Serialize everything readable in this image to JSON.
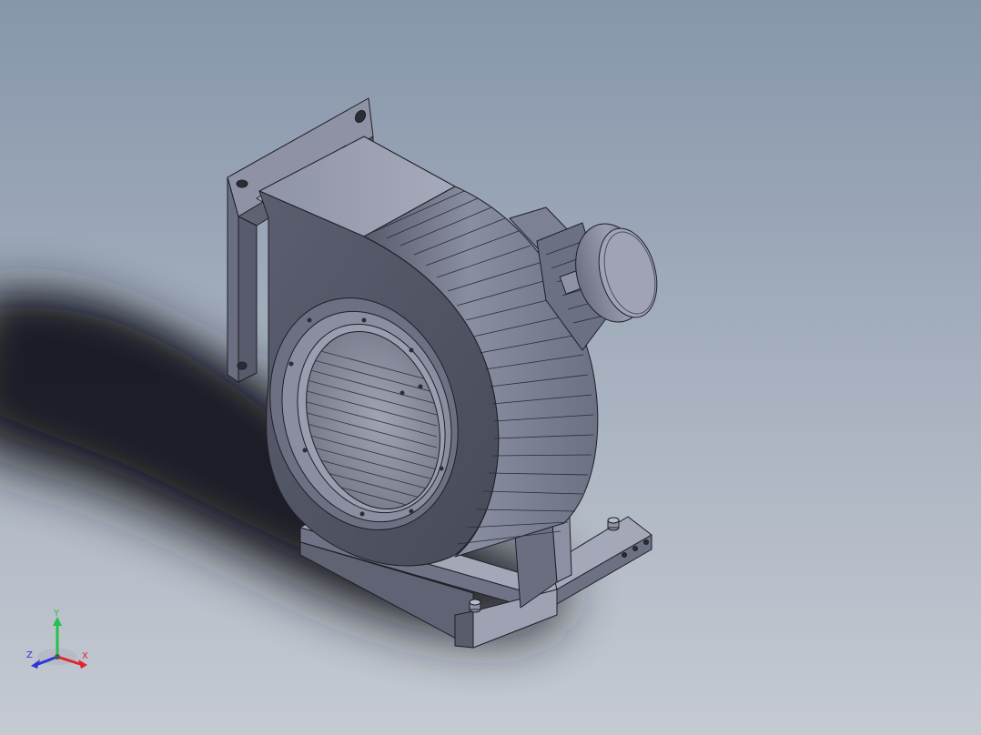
{
  "viewport": {
    "background_top": "#8796ab",
    "background_bottom": "#c4c9d1"
  },
  "model": {
    "name": "centrifugal-blower",
    "body_color": "#7a7e90",
    "edge_color": "#1e1f26"
  },
  "triad": {
    "x_label": "X",
    "y_label": "Y",
    "z_label": "Z",
    "x_color": "#e0242c",
    "y_color": "#23c24a",
    "z_color": "#2b36d9"
  }
}
